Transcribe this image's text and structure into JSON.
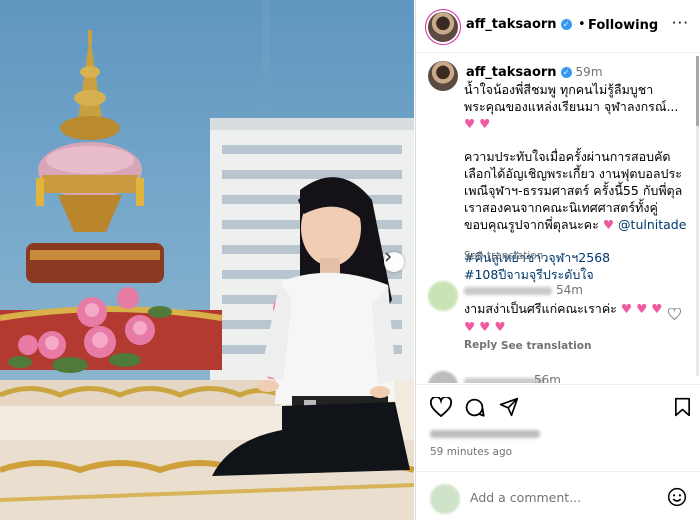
{
  "post": {
    "image_alt": "",
    "next_icon": "chevron-right-icon"
  },
  "header": {
    "username": "aff_taksaorn",
    "verified_icon": "verified-badge-icon",
    "separator": "•",
    "following_label": "Following",
    "more_label": "···"
  },
  "caption": {
    "username": "aff_taksaorn",
    "time": "59m",
    "line1": "น้ำใจน้องพี่สีชมพู ทุกคนไม่รู้ลืมบูชา พระคุณของแหล่งเรียนมา จุฬาลงกรณ์...",
    "hearts1": "♥ ♥",
    "line2": "ความประทับใจเมื่อครั้งผ่านการสอบคัดเลือกได้อัญเชิญพระเกี้ยว งานฟุตบอลประเพณีจุฬาฯ-ธรรมศาสตร์ ครั้งนี้55 กับพี่ตุล เราสองคนจากคณะนิเทศศาสตร์ทั้งคู่ ขอบคุณรูปจากพี่ตุลนะคะ",
    "heart2": "♥",
    "mention": "@tulnitade",
    "hashtag1": "#คืนสู่เหย้าชาวจุฬาฯ2568",
    "hashtag2": "#108ปีจามจุรีประดับใจ",
    "see_translation": "See translation"
  },
  "comment1": {
    "time": "54m",
    "text": "งามสง่าเป็นศรีแก่คณะเราค่ะ",
    "hearts": "♥ ♥ ♥ ♥ ♥ ♥",
    "reply_label": "Reply",
    "see_translation": "See translation"
  },
  "comment2": {
    "time": "56m"
  },
  "actions": {
    "like_icon": "heart-icon",
    "comment_icon": "comment-icon",
    "share_icon": "send-icon",
    "save_icon": "bookmark-icon"
  },
  "post_time": "59 minutes ago",
  "add_comment": {
    "placeholder": "Add a comment...",
    "emoji_icon": "emoji-icon"
  },
  "colors": {
    "link": "#00376b",
    "heart": "#f05aa0",
    "verified": "#3897f0",
    "muted": "#737373"
  }
}
